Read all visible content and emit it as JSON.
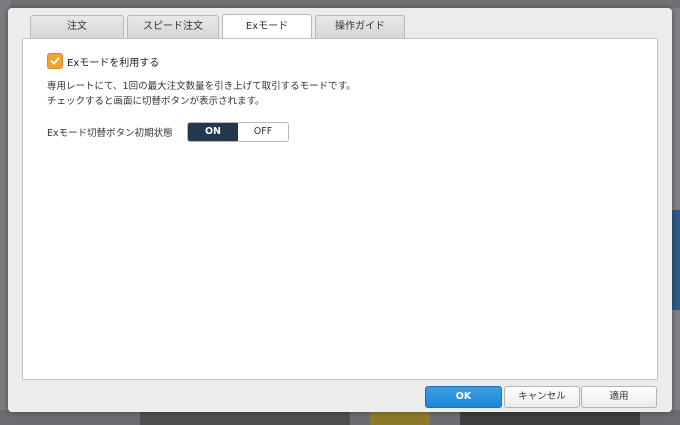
{
  "tabs": [
    {
      "label": "注文"
    },
    {
      "label": "スピード注文"
    },
    {
      "label": "Exモード"
    },
    {
      "label": "操作ガイド"
    }
  ],
  "active_tab": 2,
  "exmode": {
    "checkbox_label": "Exモードを利用する",
    "checked": true,
    "desc_line1": "専用レートにて、1回の最大注文数量を引き上げて取引するモードです。",
    "desc_line2": "チェックすると画面に切替ボタンが表示されます。",
    "toggle_label": "Exモード切替ボタン初期状態",
    "toggle_on": "ON",
    "toggle_off": "OFF",
    "toggle_selected": "ON"
  },
  "footer": {
    "ok_label": "OK",
    "cancel_label": "キャンセル",
    "apply_label": "適用"
  },
  "colors": {
    "accent": "#1d86d6",
    "checkbox": "#f0a434",
    "toggle_active": "#24374f"
  }
}
